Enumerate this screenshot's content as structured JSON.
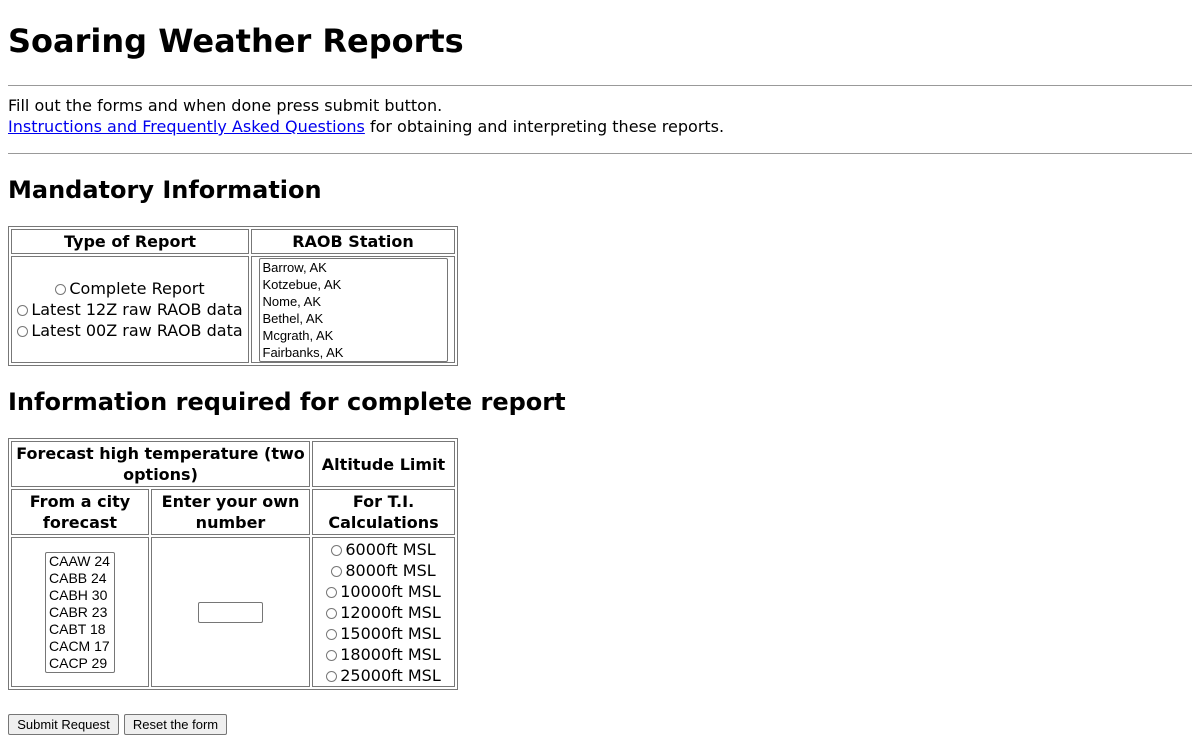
{
  "page": {
    "title": "Soaring Weather Reports",
    "intro_line": "Fill out the forms and when done press submit button.",
    "faq_link": "Instructions and Frequently Asked Questions",
    "faq_suffix": " for obtaining and interpreting these reports."
  },
  "mandatory": {
    "heading": "Mandatory Information",
    "type_header": "Type of Report",
    "station_header": "RAOB Station",
    "report_types": [
      "Complete Report",
      "Latest 12Z raw RAOB data",
      "Latest 00Z raw RAOB data"
    ],
    "stations": [
      "Barrow, AK",
      "Kotzebue, AK",
      "Nome, AK",
      "Bethel, AK",
      "Mcgrath, AK",
      "Fairbanks, AK"
    ]
  },
  "complete": {
    "heading": "Information required for complete report",
    "forecast_header": "Forecast high temperature (two options)",
    "altitude_header": "Altitude Limit",
    "city_header": "From a city forecast",
    "own_header": "Enter your own number",
    "ti_header": "For T.I. Calculations",
    "city_options": [
      "CAAW 24",
      "CABB 24",
      "CABH 30",
      "CABR 23",
      "CABT 18",
      "CACM 17",
      "CACP 29"
    ],
    "own_value": "",
    "altitudes": [
      "6000ft MSL",
      "8000ft MSL",
      "10000ft MSL",
      "12000ft MSL",
      "15000ft MSL",
      "18000ft MSL",
      "25000ft MSL"
    ]
  },
  "buttons": {
    "submit": "Submit Request",
    "reset": "Reset the form"
  }
}
